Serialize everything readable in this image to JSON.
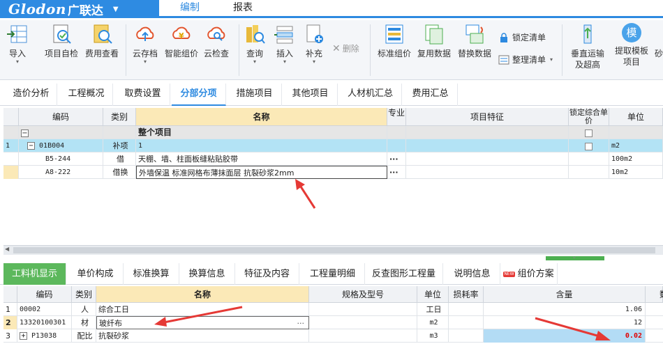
{
  "app": {
    "logo_en": "Glodon",
    "logo_cn": "广联达",
    "top_tabs": [
      "编制",
      "报表"
    ]
  },
  "ribbon": {
    "buttons": [
      {
        "label": "导入",
        "has_dropdown": true
      },
      {
        "label": "项目自检"
      },
      {
        "label": "费用查看"
      },
      {
        "label": "云存档",
        "has_dropdown": true
      },
      {
        "label": "智能组价"
      },
      {
        "label": "云检查"
      },
      {
        "label": "查询",
        "has_dropdown": true
      },
      {
        "label": "插入",
        "has_dropdown": true
      },
      {
        "label": "补充",
        "has_dropdown": true
      },
      {
        "label": "删除"
      },
      {
        "label": "标准组价"
      },
      {
        "label": "复用数据"
      },
      {
        "label": "替换数据"
      },
      {
        "label": "锁定清单"
      },
      {
        "label": "整理清单"
      },
      {
        "label": "垂直运输"
      },
      {
        "label": "及超高"
      },
      {
        "label": "提取模板"
      },
      {
        "label": "项目"
      },
      {
        "label": "砂"
      }
    ],
    "template_icon_text": "模"
  },
  "section_tabs": [
    "造价分析",
    "工程概况",
    "取费设置",
    "分部分项",
    "措施项目",
    "其他项目",
    "人材机汇总",
    "费用汇总"
  ],
  "upper_grid": {
    "headers": {
      "code": "编码",
      "category": "类别",
      "name": "名称",
      "major": "专业",
      "feature": "项目特征",
      "lock_price": "锁定综合单价",
      "unit": "单位"
    },
    "rows": [
      {
        "num": "",
        "code": "",
        "category": "",
        "name": "整个项目",
        "unit": ""
      },
      {
        "num": "1",
        "code": "01B004",
        "category": "补项",
        "name": "1",
        "unit": "m2"
      },
      {
        "num": "",
        "code": "B5-244",
        "category": "借",
        "name": "天棚、墙、柱面板缝粘贴胶带",
        "unit": "100m2"
      },
      {
        "num": "",
        "code": "A8-222",
        "category": "借换",
        "name": "外墙保温 标准网格布薄抹面层 抗裂砂浆2mm",
        "unit": "10m2"
      }
    ],
    "ellipsis": "···"
  },
  "detail_tabs": [
    "工料机显示",
    "单价构成",
    "标准换算",
    "换算信息",
    "特征及内容",
    "工程量明细",
    "反查图形工程量",
    "说明信息",
    "组价方案"
  ],
  "new_badge": "NEW",
  "lower_grid": {
    "headers": {
      "code": "编码",
      "category": "类别",
      "name": "名称",
      "spec": "规格及型号",
      "unit": "单位",
      "loss": "损耗率",
      "qty": "含量",
      "more": "数"
    },
    "rows": [
      {
        "num": "1",
        "code": "00002",
        "category": "人",
        "name": "综合工日",
        "unit": "工日",
        "qty": "1.06"
      },
      {
        "num": "2",
        "code": "13320100301",
        "category": "材",
        "name": "玻纤布",
        "unit": "m2",
        "qty": "12"
      },
      {
        "num": "3",
        "code": "P13038",
        "category": "配比",
        "name": "抗裂砂浆",
        "unit": "m3",
        "qty": "0.02"
      }
    ],
    "ellipsis": "···"
  },
  "colors": {
    "accent": "#2d8ae0",
    "active_tab_green": "#5cb85c",
    "selected_row": "#b3e3f5",
    "header_highlight": "#fbe9b7",
    "arrow": "#e53935",
    "qty_highlight": "#b3dcf5",
    "qty_red": "#e00000"
  }
}
